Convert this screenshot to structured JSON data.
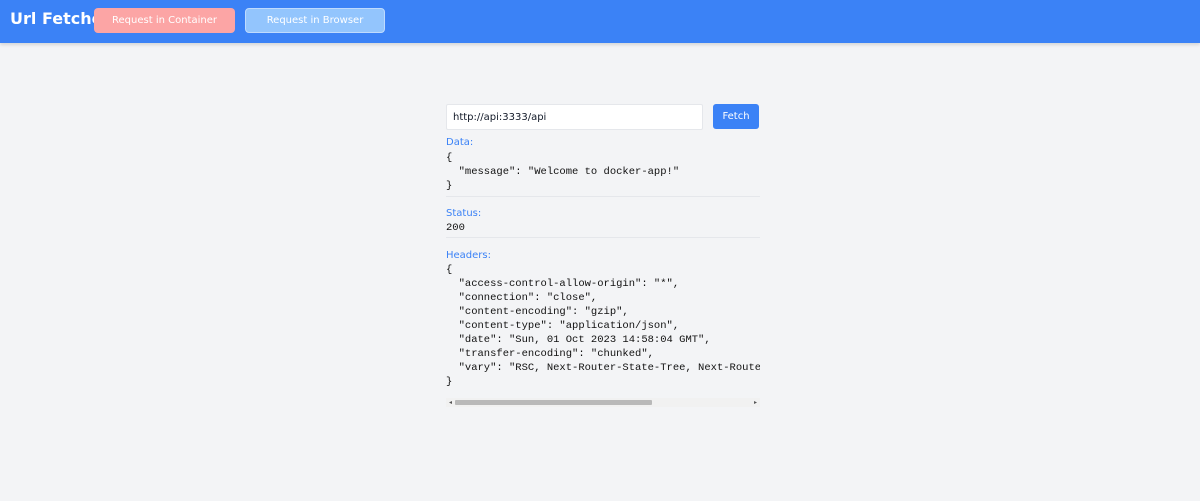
{
  "header": {
    "title": "Url Fetcher",
    "buttons": {
      "container_label": "Request in Container",
      "browser_label": "Request in Browser"
    },
    "colors": {
      "bar": "#3b82f6",
      "container_button": "#fca5a5",
      "browser_button": "#93c5fd"
    }
  },
  "form": {
    "url_value": "http://api:3333/api",
    "fetch_label": "Fetch"
  },
  "data_section": {
    "label": "Data:",
    "body": "{\n  \"message\": \"Welcome to docker-app!\"\n}"
  },
  "status_section": {
    "label": "Status:",
    "value": "200"
  },
  "headers_section": {
    "label": "Headers:",
    "body": "{\n  \"access-control-allow-origin\": \"*\",\n  \"connection\": \"close\",\n  \"content-encoding\": \"gzip\",\n  \"content-type\": \"application/json\",\n  \"date\": \"Sun, 01 Oct 2023 14:58:04 GMT\",\n  \"transfer-encoding\": \"chunked\",\n  \"vary\": \"RSC, Next-Router-State-Tree, Next-Router-\n}"
  },
  "scrollbar": {
    "left_arrow": "◂",
    "right_arrow": "▸"
  }
}
